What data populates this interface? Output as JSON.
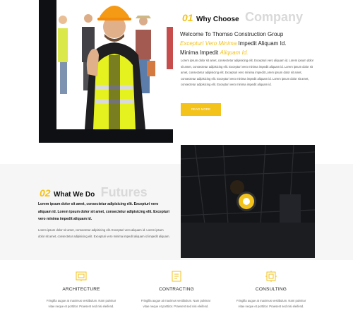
{
  "colors": {
    "accent": "#f3c21b",
    "dark": "#16171a",
    "band": "#f6f6f6"
  },
  "why_choose": {
    "number": "01",
    "title": "Why Choose",
    "ghost": "Company",
    "headline_line1": "Welcome To Thomso Construction Group",
    "headline_yellow1": "Excepturi Vero Minima",
    "headline_line2": "Impedit Aliquam Id.",
    "headline_line3": "Minima Impedit",
    "headline_yellow2": "Aliquam Id.",
    "paragraph": "Lorem ipsum dolor sit amet, consectetur adipisicing elit. Excepturi vero aliquam id. Lorem ipsum dolor sit amet, consectetur adipisicing elit. Excepturi vero minima impedit aliquam id. Lorem ipsum dolor sit amet, consectetur adipisicing elit. Excepturi vero minima impedit Lorem ipsum dolor sit amet, consectetur adipisicing elit. Excepturi vero minima impedit aliquam id. Lorem ipsum dolor sit amet, consectetur adipisicing elit. Excepturi vero minima impedit aliquam id.",
    "button_label": "READ MORE",
    "icon": "worker-photo"
  },
  "what_we_do": {
    "number": "02",
    "title": "What We Do",
    "ghost": "Futures",
    "bold_paragraph": "Lorem ipsum dolor sit amet, consectetur adipisicing elit. Excepturi vero aliquam id. Lorem ipsum dolor sit amet, consectetur adipisicing elit. Excepturi vero minima impedit aliquam id.",
    "paragraph": "Lorem ipsum dolor sit amet, consectetur adipisicing elit. Excepturi vero aliquam id. Lorem ipsum dolor sit amet, consectetur adipisicing elit. Excepturi vero minima impedit aliquam id impedit aliquam.",
    "video_icon": "play-icon"
  },
  "services": [
    {
      "title": "ARCHITECTURE",
      "text": "Fringilla augue at maximus vestibulum. Nam pulvinar vitae neque et porttitor. Praesent sed nisi eleifend.",
      "icon": "architecture-icon"
    },
    {
      "title": "CONTRACTING",
      "text": "Fringilla augue at maximus vestibulum. Nam pulvinar vitae neque et porttitor. Praesent sed nisi eleifend.",
      "icon": "contracting-icon"
    },
    {
      "title": "CONSULTING",
      "text": "Fringilla augue at maximus vestibulum. Nam pulvinar vitae neque et porttitor. Praesent sed nisi eleifend.",
      "icon": "consulting-icon"
    }
  ]
}
